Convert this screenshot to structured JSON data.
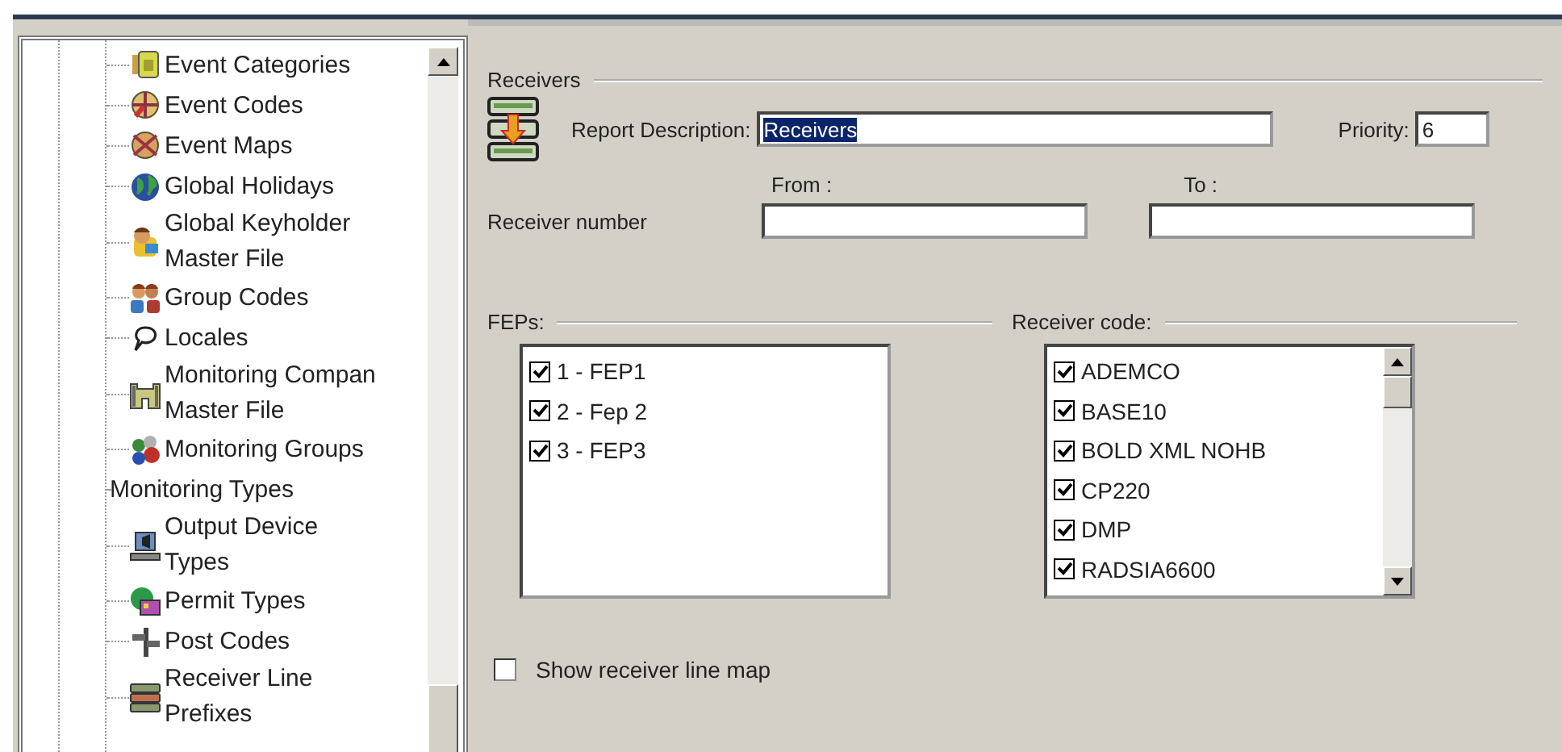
{
  "tree": {
    "items": [
      {
        "label": "Event Categories"
      },
      {
        "label": "Event Codes"
      },
      {
        "label": "Event Maps"
      },
      {
        "label": "Global Holidays"
      },
      {
        "label": "Global Keyholder\nMaster File"
      },
      {
        "label": "Group Codes"
      },
      {
        "label": "Locales"
      },
      {
        "label": "Monitoring Compan\nMaster File"
      },
      {
        "label": "Monitoring Groups"
      },
      {
        "label": "Monitoring Types"
      },
      {
        "label": "Output Device\nTypes"
      },
      {
        "label": "Permit Types"
      },
      {
        "label": "Post Codes"
      },
      {
        "label": "Receiver Line\nPrefixes"
      }
    ]
  },
  "form": {
    "group_title": "Receivers",
    "report_description": {
      "label": "Report Description:",
      "value": "Receivers",
      "text_selected": true
    },
    "priority": {
      "label": "Priority:",
      "value": "6"
    },
    "from_label": "From :",
    "to_label": "To :",
    "receiver_number": {
      "label": "Receiver number"
    },
    "feps": {
      "title": "FEPs:",
      "items": [
        {
          "label": "1 - FEP1",
          "checked": true
        },
        {
          "label": "2 - Fep 2",
          "checked": true
        },
        {
          "label": "3 - FEP3",
          "checked": true
        }
      ]
    },
    "receiver_codes": {
      "title": "Receiver code:",
      "items": [
        {
          "label": "ADEMCO",
          "checked": true
        },
        {
          "label": "BASE10",
          "checked": true
        },
        {
          "label": "BOLD XML NOHB",
          "checked": true
        },
        {
          "label": "CP220",
          "checked": true
        },
        {
          "label": "DMP",
          "checked": true
        },
        {
          "label": "RADSIA6600",
          "checked": true
        }
      ]
    },
    "show_line_map": {
      "label": "Show receiver line map",
      "checked": false
    }
  }
}
